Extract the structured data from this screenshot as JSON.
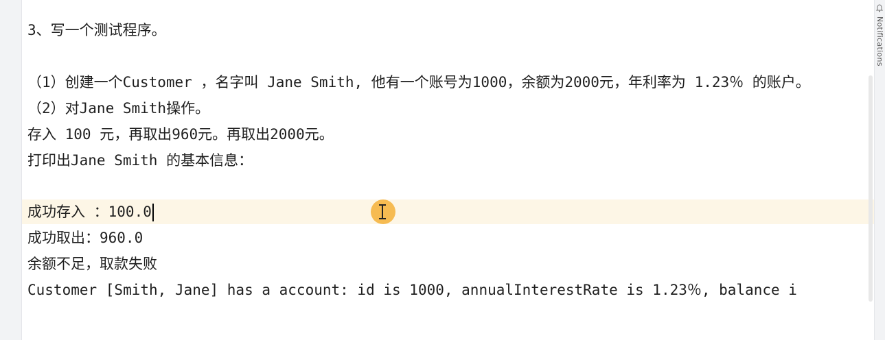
{
  "editor": {
    "lines": [
      "3、写一个测试程序。",
      "",
      "（1）创建一个Customer ，名字叫 Jane Smith, 他有一个账号为1000，余额为2000元，年利率为 1.23％ 的账户。",
      "（2）对Jane Smith操作。",
      "存入 100 元，再取出960元。再取出2000元。",
      "打印出Jane Smith 的基本信息：",
      "",
      "成功存入 ：100.0",
      "成功取出：960.0",
      "余额不足，取款失败",
      "Customer [Smith, Jane] has a account: id is 1000, annualInterestRate is 1.23％, balance i"
    ]
  },
  "side_panel": {
    "notifications_label": "Notifications"
  },
  "colors": {
    "current_line": "#fdf6e6",
    "cursor_highlight": "#f5b037"
  }
}
